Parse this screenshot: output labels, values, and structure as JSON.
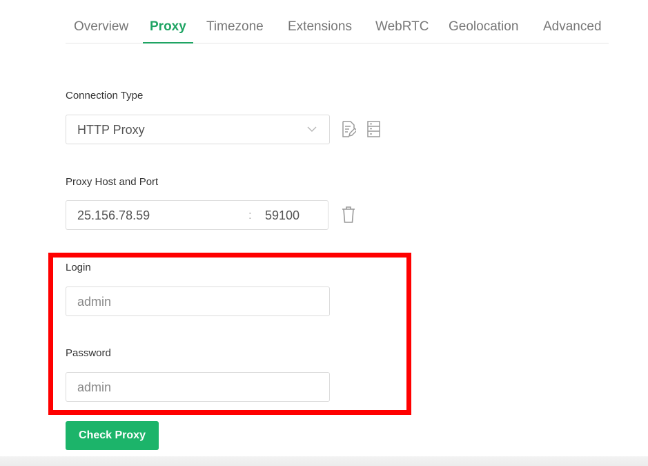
{
  "tabs": [
    {
      "label": "Overview",
      "active": false
    },
    {
      "label": "Proxy",
      "active": true
    },
    {
      "label": "Timezone",
      "active": false
    },
    {
      "label": "Extensions",
      "active": false
    },
    {
      "label": "WebRTC",
      "active": false
    },
    {
      "label": "Geolocation",
      "active": false
    },
    {
      "label": "Advanced",
      "active": false
    }
  ],
  "connection": {
    "label": "Connection Type",
    "value": "HTTP Proxy",
    "icons": [
      "chevron-down-icon",
      "edit-icon",
      "list-icon"
    ]
  },
  "host": {
    "label": "Proxy Host and Port",
    "host_value": "25.156.78.59",
    "separator": ":",
    "port_value": "59100",
    "icon": "trash-icon"
  },
  "login": {
    "label": "Login",
    "value": "admin"
  },
  "password": {
    "label": "Password",
    "value": "admin"
  },
  "actions": {
    "check_label": "Check Proxy"
  },
  "colors": {
    "accent": "#1fa463",
    "button": "#1cb46a",
    "highlight": "#ff0000"
  }
}
